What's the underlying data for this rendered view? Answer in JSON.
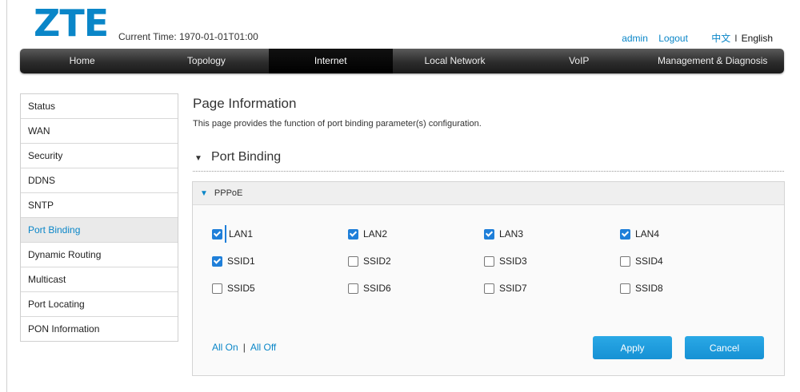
{
  "header": {
    "logo_text": "ZTE",
    "current_time": "Current Time: 1970-01-01T01:00",
    "user": "admin",
    "logout": "Logout",
    "lang_cn": "中文",
    "lang_sep": "I",
    "lang_en": "English"
  },
  "nav": {
    "items": [
      "Home",
      "Topology",
      "Internet",
      "Local Network",
      "VoIP",
      "Management & Diagnosis"
    ],
    "active": "Internet"
  },
  "sidebar": {
    "items": [
      "Status",
      "WAN",
      "Security",
      "DDNS",
      "SNTP",
      "Port Binding",
      "Dynamic Routing",
      "Multicast",
      "Port Locating",
      "PON Information"
    ],
    "active": "Port Binding"
  },
  "main": {
    "page_title": "Page Information",
    "page_desc": "This page provides the function of port binding parameter(s) configuration.",
    "section_title": "Port Binding",
    "panel_title": "PPPoE",
    "ports": [
      {
        "label": "LAN1",
        "checked": true
      },
      {
        "label": "LAN2",
        "checked": true
      },
      {
        "label": "LAN3",
        "checked": true
      },
      {
        "label": "LAN4",
        "checked": true
      },
      {
        "label": "SSID1",
        "checked": true
      },
      {
        "label": "SSID2",
        "checked": false
      },
      {
        "label": "SSID3",
        "checked": false
      },
      {
        "label": "SSID4",
        "checked": false
      },
      {
        "label": "SSID5",
        "checked": false
      },
      {
        "label": "SSID6",
        "checked": false
      },
      {
        "label": "SSID7",
        "checked": false
      },
      {
        "label": "SSID8",
        "checked": false
      }
    ],
    "all_on": "All On",
    "link_sep": "|",
    "all_off": "All Off",
    "apply_label": "Apply",
    "cancel_label": "Cancel"
  },
  "colors": {
    "brand": "#0a86c8",
    "checkbox": "#1f7fd9",
    "button": "#1a9bdc"
  }
}
